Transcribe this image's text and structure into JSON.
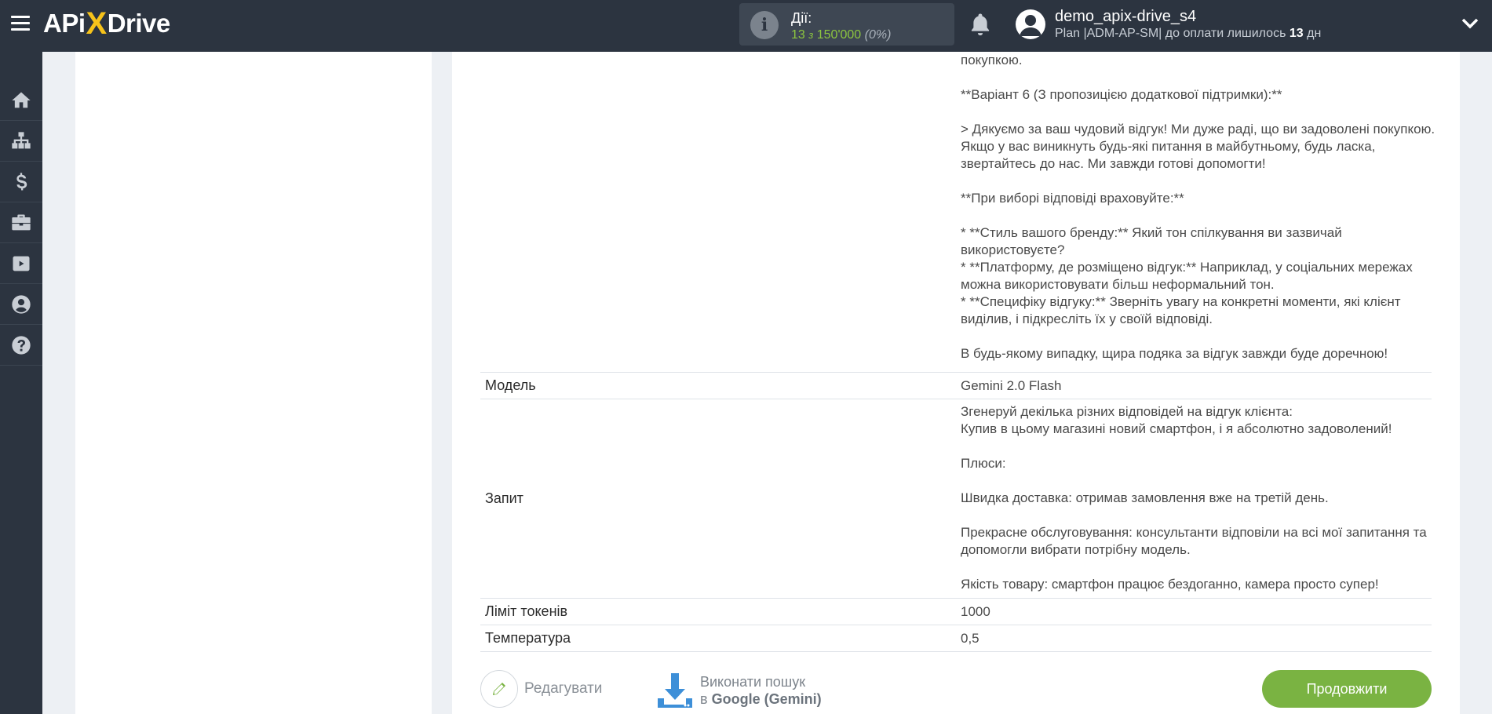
{
  "header": {
    "logo_left": "APi",
    "logo_x": "X",
    "logo_right": "Drive",
    "actions_label": "Дії:",
    "actions_used": "13",
    "actions_of": "з",
    "actions_total": "150'000",
    "actions_percent": "(0%)",
    "user_name": "demo_apix-drive_s4",
    "plan_text": "Plan |ADM-AP-SM| до оплати лишилось",
    "plan_days": "13",
    "plan_days_unit": "дн"
  },
  "sidebar": {
    "items": [
      "home-icon",
      "sitemap-icon",
      "dollar-icon",
      "briefcase-icon",
      "youtube-icon",
      "user-icon",
      "help-icon"
    ]
  },
  "response": {
    "text": "покупкою.\n\n**Варіант 6 (З пропозицією додаткової підтримки):**\n\n> Дякуємо за ваш чудовий відгук! Ми дуже раді, що ви задоволені покупкою. Якщо у вас виникнуть будь-які питання в майбутньому, будь ласка, звертайтесь до нас. Ми завжди готові допомогти!\n\n**При виборі відповіді враховуйте:**\n\n* **Стиль вашого бренду:** Який тон спілкування ви зазвичай використовуєте?\n* **Платформу, де розміщено відгук:** Наприклад, у соціальних мережах можна використовувати більш неформальний тон.\n* **Специфіку відгуку:** Зверніть увагу на конкретні моменти, які клієнт виділив, і підкресліть їх у своїй відповіді.\n\nВ будь-якому випадку, щира подяка за відгук завжди буде доречною!"
  },
  "fields": {
    "model_label": "Модель",
    "model_value": "Gemini 2.0 Flash",
    "query_label": "Запит",
    "query_value": "Згенеруй декілька різних відповідей на відгук клієнта:\nКупив в цьому магазині новий смартфон, і я абсолютно задоволений!\n\nПлюси:\n\nШвидка доставка: отримав замовлення вже на третій день.\n\nПрекрасне обслуговування: консультанти відповіли на всі мої запитання та допомогли вибрати потрібну модель.\n\nЯкість товару: смартфон працює бездоганно, камера просто супер!",
    "tokens_label": "Ліміт токенів",
    "tokens_value": "1000",
    "temp_label": "Температура",
    "temp_value": "0,5"
  },
  "buttons": {
    "edit_label": "Редагувати",
    "search_line1": "Виконати пошук",
    "search_prefix": "в",
    "search_service": "Google (Gemini)",
    "continue_label": "Продовжити"
  },
  "colors": {
    "topbar": "#2c3440",
    "accent_green": "#7ab342",
    "logo_yellow": "#f7c31a",
    "actions_green": "#8dc63f"
  }
}
